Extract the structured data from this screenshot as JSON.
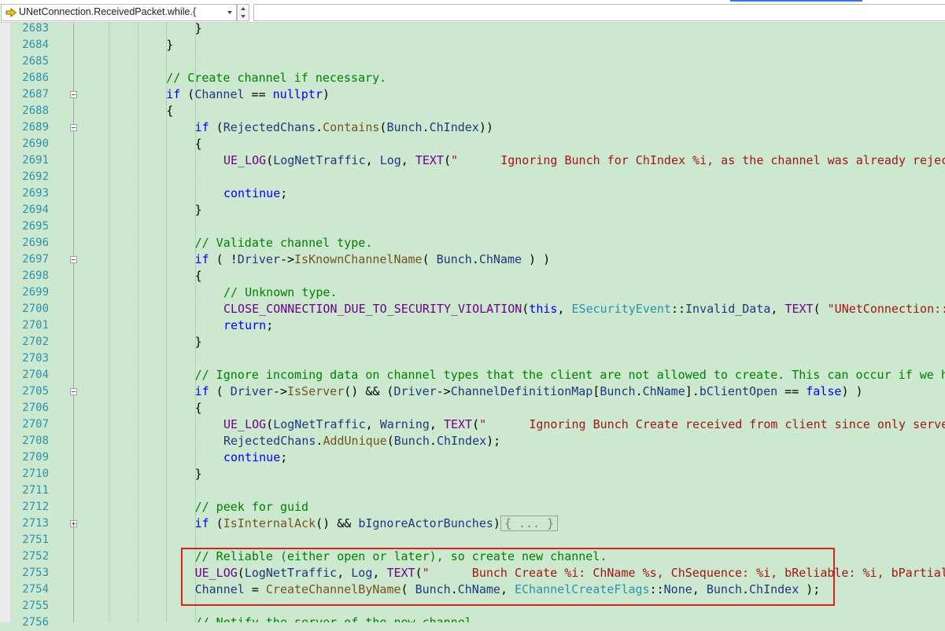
{
  "navbar": {
    "scope_text": "UNetConnection.ReceivedPacket.while.{",
    "icons": {
      "scope": "yellow-arrow-icon",
      "dropdown": "chevron-down-icon",
      "spin_up": "triangle-up-icon",
      "spin_down": "triangle-down-icon"
    },
    "right_combo_value": ""
  },
  "gutter": {
    "line_numbers": [
      "2683",
      "2684",
      "2685",
      "2686",
      "2687",
      "2688",
      "2689",
      "2690",
      "2691",
      "2692",
      "2693",
      "2694",
      "2695",
      "2696",
      "2697",
      "2698",
      "2699",
      "2700",
      "2701",
      "2702",
      "2703",
      "2704",
      "2705",
      "2706",
      "2707",
      "2708",
      "2709",
      "2710",
      "2711",
      "2712",
      "2713",
      "2751",
      "2752",
      "2753",
      "2754",
      "2755",
      "2756"
    ],
    "fold_markers": [
      {
        "line": "2687",
        "state": "expanded"
      },
      {
        "line": "2689",
        "state": "expanded"
      },
      {
        "line": "2697",
        "state": "expanded"
      },
      {
        "line": "2705",
        "state": "expanded"
      },
      {
        "line": "2713",
        "state": "collapsed"
      }
    ]
  },
  "colors": {
    "background": "#cce8cf",
    "keyword": "#0000ff",
    "comment": "#008000",
    "string": "#a31515",
    "macro": "#6f008a",
    "function": "#74531f",
    "type": "#2b91af",
    "variable": "#1f377f",
    "highlight_box": "#e0201c"
  },
  "code": {
    "lines": [
      [
        [
          "",
          "}"
        ]
      ],
      [
        [
          "",
          "}"
        ]
      ],
      [],
      [
        [
          "cm",
          "// Create channel if necessary."
        ]
      ],
      [
        [
          "kw",
          "if"
        ],
        [
          "",
          " ("
        ],
        [
          "vr",
          "Channel"
        ],
        [
          "",
          " == "
        ],
        [
          "kw",
          "nullptr"
        ],
        [
          "",
          ")"
        ]
      ],
      [
        [
          "",
          "{"
        ]
      ],
      [
        [
          "kw",
          "if"
        ],
        [
          "",
          " ("
        ],
        [
          "vr",
          "RejectedChans"
        ],
        [
          "",
          "."
        ],
        [
          "fn",
          "Contains"
        ],
        [
          "",
          "("
        ],
        [
          "vr",
          "Bunch"
        ],
        [
          "",
          "."
        ],
        [
          "vr",
          "ChIndex"
        ],
        [
          "",
          "))"
        ]
      ],
      [
        [
          "",
          "{"
        ]
      ],
      [
        [
          "mc",
          "UE_LOG"
        ],
        [
          "",
          "("
        ],
        [
          "vr",
          "LogNetTraffic"
        ],
        [
          "",
          ", "
        ],
        [
          "vr",
          "Log"
        ],
        [
          "",
          ", "
        ],
        [
          "mc",
          "TEXT"
        ],
        [
          "",
          "("
        ],
        [
          "st",
          "\"      Ignoring Bunch for ChIndex %i, as the channel was already reject"
        ]
      ],
      [],
      [
        [
          "kw",
          "continue"
        ],
        [
          "",
          ";"
        ]
      ],
      [
        [
          "",
          "}"
        ]
      ],
      [],
      [
        [
          "cm",
          "// Validate channel type."
        ]
      ],
      [
        [
          "kw",
          "if"
        ],
        [
          "",
          " ( !"
        ],
        [
          "vr",
          "Driver"
        ],
        [
          "",
          "->"
        ],
        [
          "fn",
          "IsKnownChannelName"
        ],
        [
          "",
          "( "
        ],
        [
          "vr",
          "Bunch"
        ],
        [
          "",
          "."
        ],
        [
          "vr",
          "ChName"
        ],
        [
          "",
          " ) )"
        ]
      ],
      [
        [
          "",
          "{"
        ]
      ],
      [
        [
          "cm",
          "// Unknown type."
        ]
      ],
      [
        [
          "mc",
          "CLOSE_CONNECTION_DUE_TO_SECURITY_VIOLATION"
        ],
        [
          "",
          "("
        ],
        [
          "kw",
          "this"
        ],
        [
          "",
          ", "
        ],
        [
          "ty",
          "ESecurityEvent"
        ],
        [
          "",
          "::"
        ],
        [
          "vr",
          "Invalid_Data"
        ],
        [
          "",
          ", "
        ],
        [
          "mc",
          "TEXT"
        ],
        [
          "",
          "( "
        ],
        [
          "st",
          "\"UNetConnection::R"
        ]
      ],
      [
        [
          "kw",
          "return"
        ],
        [
          "",
          ";"
        ]
      ],
      [
        [
          "",
          "}"
        ]
      ],
      [],
      [
        [
          "cm",
          "// Ignore incoming data on channel types that the client are not allowed to create. This can occur if we ha"
        ]
      ],
      [
        [
          "kw",
          "if"
        ],
        [
          "",
          " ( "
        ],
        [
          "vr",
          "Driver"
        ],
        [
          "",
          "->"
        ],
        [
          "fn",
          "IsServer"
        ],
        [
          "",
          "() && ("
        ],
        [
          "vr",
          "Driver"
        ],
        [
          "",
          "->"
        ],
        [
          "vr",
          "ChannelDefinitionMap"
        ],
        [
          "",
          "["
        ],
        [
          "vr",
          "Bunch"
        ],
        [
          "",
          "."
        ],
        [
          "vr",
          "ChName"
        ],
        [
          "",
          "]."
        ],
        [
          "vr",
          "bClientOpen"
        ],
        [
          "",
          " == "
        ],
        [
          "kw",
          "false"
        ],
        [
          "",
          ") )"
        ]
      ],
      [
        [
          "",
          "{"
        ]
      ],
      [
        [
          "mc",
          "UE_LOG"
        ],
        [
          "",
          "("
        ],
        [
          "vr",
          "LogNetTraffic"
        ],
        [
          "",
          ", "
        ],
        [
          "vr",
          "Warning"
        ],
        [
          "",
          ", "
        ],
        [
          "mc",
          "TEXT"
        ],
        [
          "",
          "("
        ],
        [
          "st",
          "\"      Ignoring Bunch Create received from client since only server"
        ]
      ],
      [
        [
          "vr",
          "RejectedChans"
        ],
        [
          "",
          "."
        ],
        [
          "fn",
          "AddUnique"
        ],
        [
          "",
          "("
        ],
        [
          "vr",
          "Bunch"
        ],
        [
          "",
          "."
        ],
        [
          "vr",
          "ChIndex"
        ],
        [
          "",
          ");"
        ]
      ],
      [
        [
          "kw",
          "continue"
        ],
        [
          "",
          ";"
        ]
      ],
      [
        [
          "",
          "}"
        ]
      ],
      [],
      [
        [
          "cm",
          "// peek for guid"
        ]
      ],
      [
        [
          "kw",
          "if"
        ],
        [
          "",
          " ("
        ],
        [
          "fn",
          "IsInternalAck"
        ],
        [
          "",
          "() && "
        ],
        [
          "vr",
          "bIgnoreActorBunches"
        ],
        [
          "",
          ")"
        ],
        [
          "collapsed",
          "{ ... }"
        ]
      ],
      [],
      [
        [
          "cm",
          "// Reliable (either open or later), so create new channel."
        ]
      ],
      [
        [
          "mc",
          "UE_LOG"
        ],
        [
          "",
          "("
        ],
        [
          "vr",
          "LogNetTraffic"
        ],
        [
          "",
          ", "
        ],
        [
          "vr",
          "Log"
        ],
        [
          "",
          ", "
        ],
        [
          "mc",
          "TEXT"
        ],
        [
          "",
          "("
        ],
        [
          "st",
          "\"      Bunch Create %i: ChName %s, ChSequence: %i, bReliable: %i, bPartial"
        ]
      ],
      [
        [
          "vr",
          "Channel"
        ],
        [
          "",
          " = "
        ],
        [
          "fn",
          "CreateChannelByName"
        ],
        [
          "",
          "( "
        ],
        [
          "vr",
          "Bunch"
        ],
        [
          "",
          "."
        ],
        [
          "vr",
          "ChName"
        ],
        [
          "",
          ", "
        ],
        [
          "ty",
          "EChannelCreateFlags"
        ],
        [
          "",
          "::"
        ],
        [
          "vr",
          "None"
        ],
        [
          "",
          ", "
        ],
        [
          "vr",
          "Bunch"
        ],
        [
          "",
          "."
        ],
        [
          "vr",
          "ChIndex"
        ],
        [
          "",
          " );"
        ]
      ],
      [],
      [
        [
          "cm",
          "// Notify the server of the new channel."
        ]
      ]
    ]
  }
}
